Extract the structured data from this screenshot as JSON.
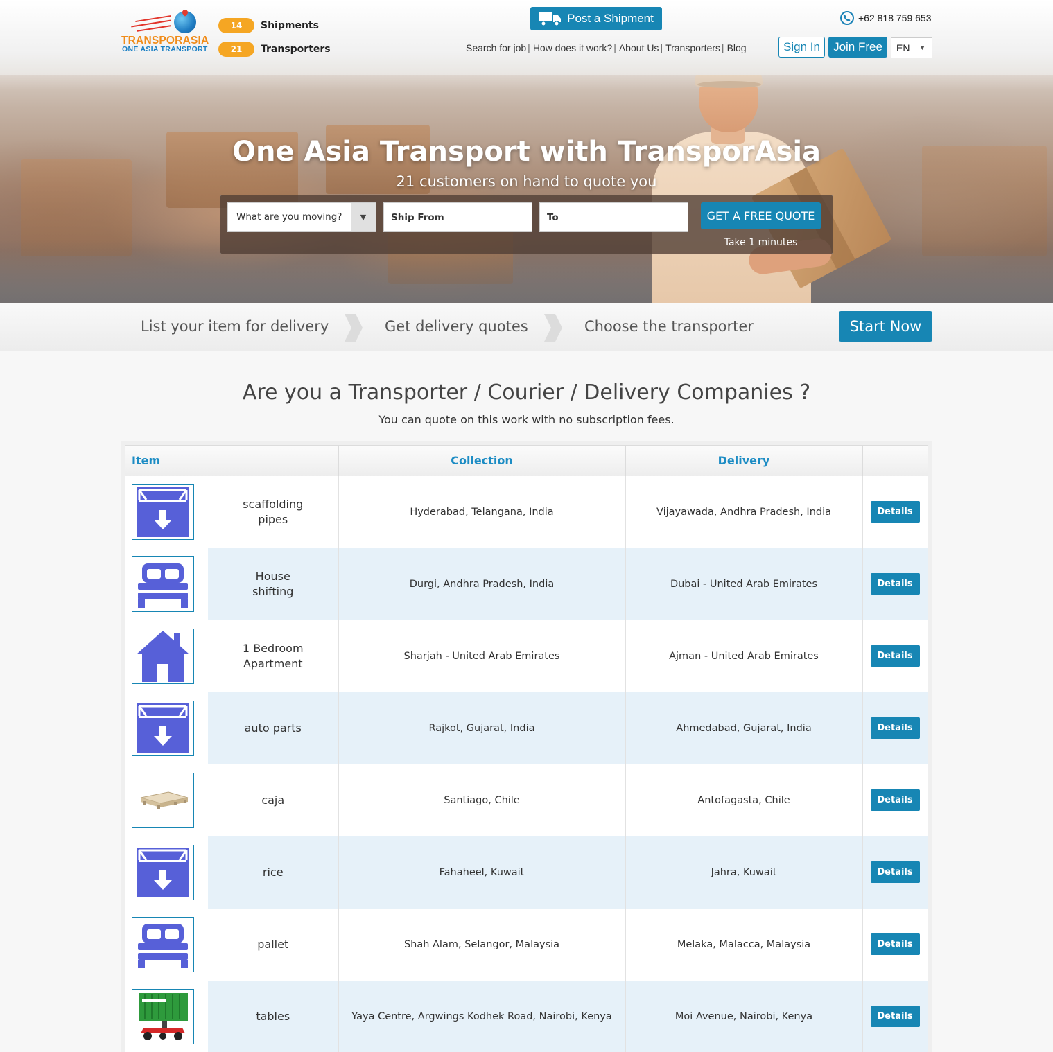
{
  "brand": {
    "name": "TRANSPORASIA",
    "tagline": "ONE ASIA TRANSPORT"
  },
  "stats": [
    {
      "count": "14",
      "label": "Shipments"
    },
    {
      "count": "21",
      "label": "Transporters"
    }
  ],
  "header": {
    "post_label": "Post a Shipment",
    "phone": "+62 818 759 653",
    "nav": [
      "Search for job",
      "How does it work?",
      "About Us",
      "Transporters",
      "Blog"
    ],
    "signin_label": "Sign In",
    "join_label": "Join Free",
    "language": "EN"
  },
  "hero": {
    "title": "One Asia Transport with TransporAsia",
    "subtitle": "21 customers on hand to quote you",
    "select_placeholder": "What are you moving?",
    "from_placeholder": "Ship From",
    "to_placeholder": "To",
    "quote_label": "GET A FREE QUOTE",
    "quote_note": "Take 1 minutes"
  },
  "steps": {
    "items": [
      "List your item for delivery",
      "Get delivery quotes",
      "Choose the transporter"
    ],
    "start_label": "Start Now"
  },
  "section": {
    "title": "Are you a Transporter / Courier / Delivery Companies ?",
    "subtitle": "You can quote on this work with no subscription fees."
  },
  "table": {
    "headers": {
      "item": "Item",
      "collection": "Collection",
      "delivery": "Delivery"
    },
    "details_label": "Details",
    "rows": [
      {
        "icon": "box-down-icon",
        "item": "scaffolding pipes",
        "collection": "Hyderabad, Telangana, India",
        "delivery": "Vijayawada, Andhra Pradesh, India"
      },
      {
        "icon": "bed-icon",
        "item": "House shifting",
        "collection": "Durgi, Andhra Pradesh, India",
        "delivery": "Dubai - United Arab Emirates"
      },
      {
        "icon": "house-icon",
        "item": "1 Bedroom Apartment",
        "collection": "Sharjah - United Arab Emirates",
        "delivery": "Ajman - United Arab Emirates"
      },
      {
        "icon": "box-down-icon",
        "item": "auto parts",
        "collection": "Rajkot, Gujarat, India",
        "delivery": "Ahmedabad, Gujarat, India"
      },
      {
        "icon": "pallet-icon",
        "item": "caja",
        "collection": "Santiago, Chile",
        "delivery": "Antofagasta, Chile"
      },
      {
        "icon": "box-down-icon",
        "item": "rice",
        "collection": "Fahaheel, Kuwait",
        "delivery": "Jahra, Kuwait"
      },
      {
        "icon": "bed-icon",
        "item": "pallet",
        "collection": "Shah Alam, Selangor, Malaysia",
        "delivery": "Melaka, Malacca, Malaysia"
      },
      {
        "icon": "container-icon",
        "item": "tables",
        "collection": "Yaya Centre, Argwings Kodhek Road, Nairobi, Kenya",
        "delivery": "Moi Avenue, Nairobi, Kenya"
      }
    ]
  },
  "colors": {
    "accent": "#1786b4",
    "badge": "#f5a623",
    "row_alt": "#e6f1f9",
    "icon_blue": "#5760d8"
  }
}
